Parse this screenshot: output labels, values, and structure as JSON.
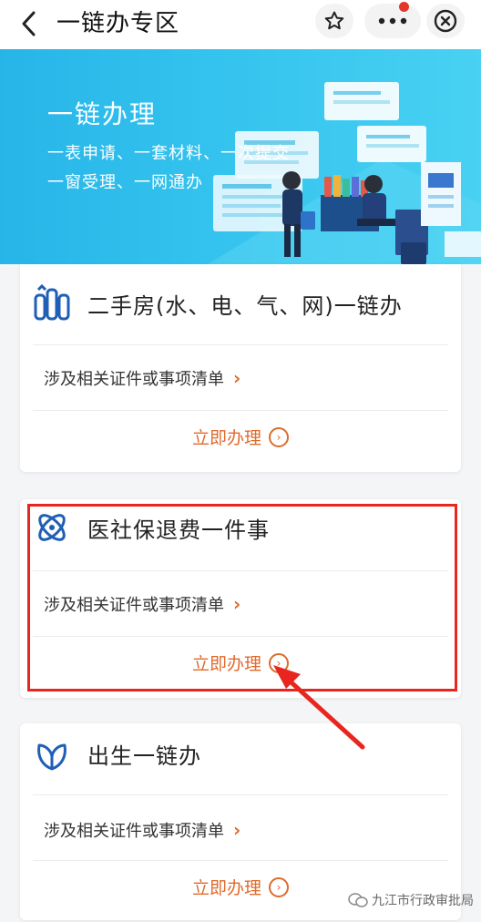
{
  "header": {
    "title": "一链办专区",
    "icons": [
      "back-icon",
      "star-icon",
      "more-icon",
      "close-icon"
    ]
  },
  "banner": {
    "title": "一链办理",
    "line1": "一表申请、一套材料、一次提交",
    "line2": "一窗受理、一网通办"
  },
  "cards": [
    {
      "title": "二手房(水、电、气、网)一链办",
      "list_link": "涉及相关证件或事项清单",
      "action": "立即办理",
      "icon": "building-icon"
    },
    {
      "title": "医社保退费一件事",
      "list_link": "涉及相关证件或事项清单",
      "action": "立即办理",
      "icon": "atom-icon"
    },
    {
      "title": "出生一链办",
      "list_link": "涉及相关证件或事项清单",
      "action": "立即办理",
      "icon": "leaf-icon"
    }
  ],
  "watermark": "九江市行政审批局",
  "colors": {
    "accent": "#e06a2c",
    "highlight": "#e8261f",
    "banner": "#34c3ee",
    "icon": "#1f5fb5"
  }
}
